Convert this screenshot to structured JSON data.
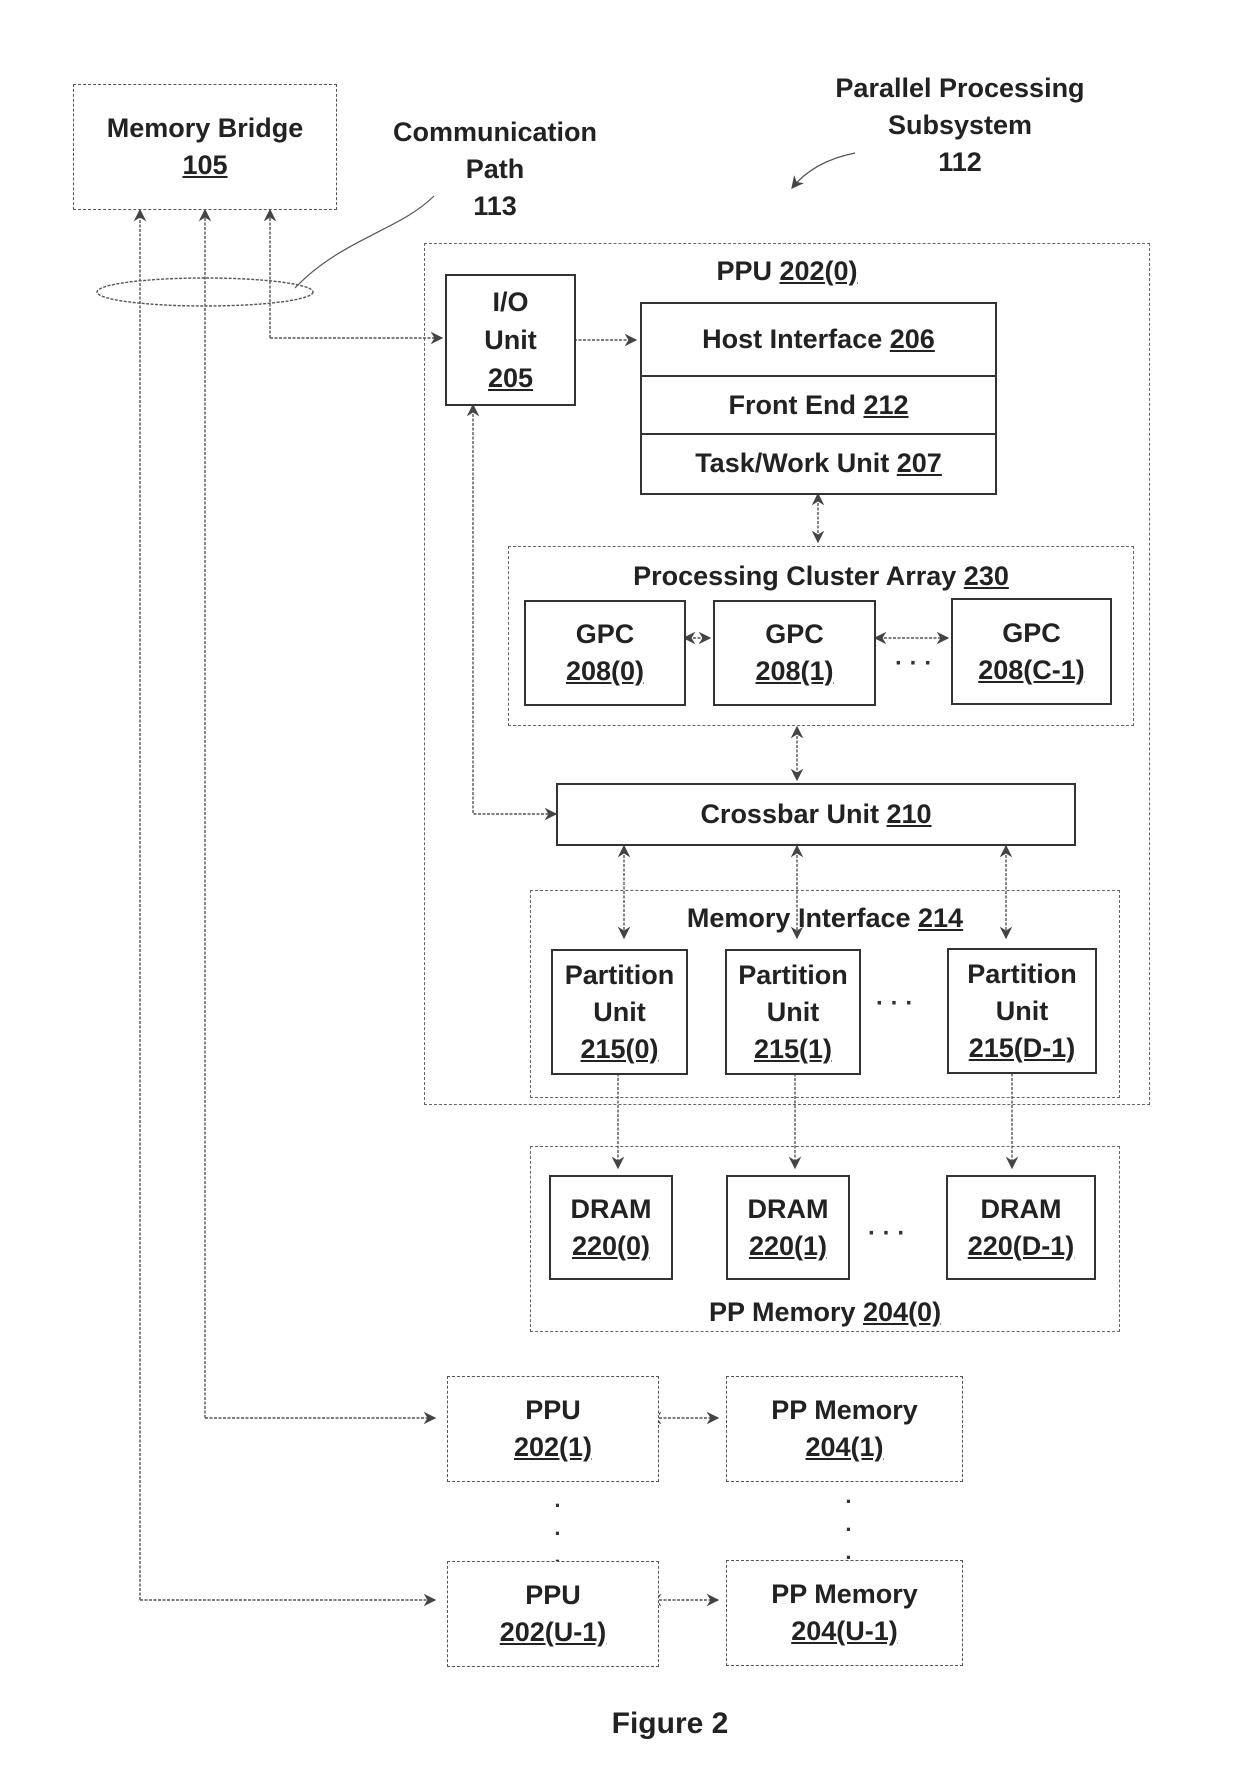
{
  "memory_bridge": {
    "name": "Memory Bridge",
    "ref": "105"
  },
  "communication_path": {
    "line1": "Communication",
    "line2": "Path",
    "ref": "113"
  },
  "subsystem": {
    "line1": "Parallel Processing",
    "line2": "Subsystem",
    "ref": "112"
  },
  "ppu0": {
    "name": "PPU",
    "ref": "202(0)"
  },
  "io_unit": {
    "line1": "I/O",
    "line2": "Unit",
    "ref": "205"
  },
  "front_stack": [
    {
      "name": "Host Interface",
      "ref": "206"
    },
    {
      "name": "Front End",
      "ref": "212"
    },
    {
      "name": "Task/Work Unit",
      "ref": "207"
    }
  ],
  "pca": {
    "name": "Processing Cluster Array",
    "ref": "230"
  },
  "gpcs": [
    {
      "name": "GPC",
      "ref": "208(0)"
    },
    {
      "name": "GPC",
      "ref": "208(1)"
    },
    {
      "name": "GPC",
      "ref": "208(C-1)"
    }
  ],
  "crossbar": {
    "name": "Crossbar Unit",
    "ref": "210"
  },
  "memory_interface": {
    "name": "Memory Interface",
    "ref": "214"
  },
  "partitions": [
    {
      "line1": "Partition",
      "line2": "Unit",
      "ref": "215(0)"
    },
    {
      "line1": "Partition",
      "line2": "Unit",
      "ref": "215(1)"
    },
    {
      "line1": "Partition",
      "line2": "Unit",
      "ref": "215(D-1)"
    }
  ],
  "drams": [
    {
      "name": "DRAM",
      "ref": "220(0)"
    },
    {
      "name": "DRAM",
      "ref": "220(1)"
    },
    {
      "name": "DRAM",
      "ref": "220(D-1)"
    }
  ],
  "pp_memory0": {
    "name": "PP Memory",
    "ref": "204(0)"
  },
  "ppu1": {
    "name": "PPU",
    "ref": "202(1)"
  },
  "ppm1": {
    "name": "PP Memory",
    "ref": "204(1)"
  },
  "ppuU": {
    "name": "PPU",
    "ref": "202(U-1)"
  },
  "ppmU": {
    "name": "PP Memory",
    "ref": "204(U-1)"
  },
  "ellipsis": "· · ·",
  "vertical_ellipsis": "·",
  "caption": "Figure 2"
}
